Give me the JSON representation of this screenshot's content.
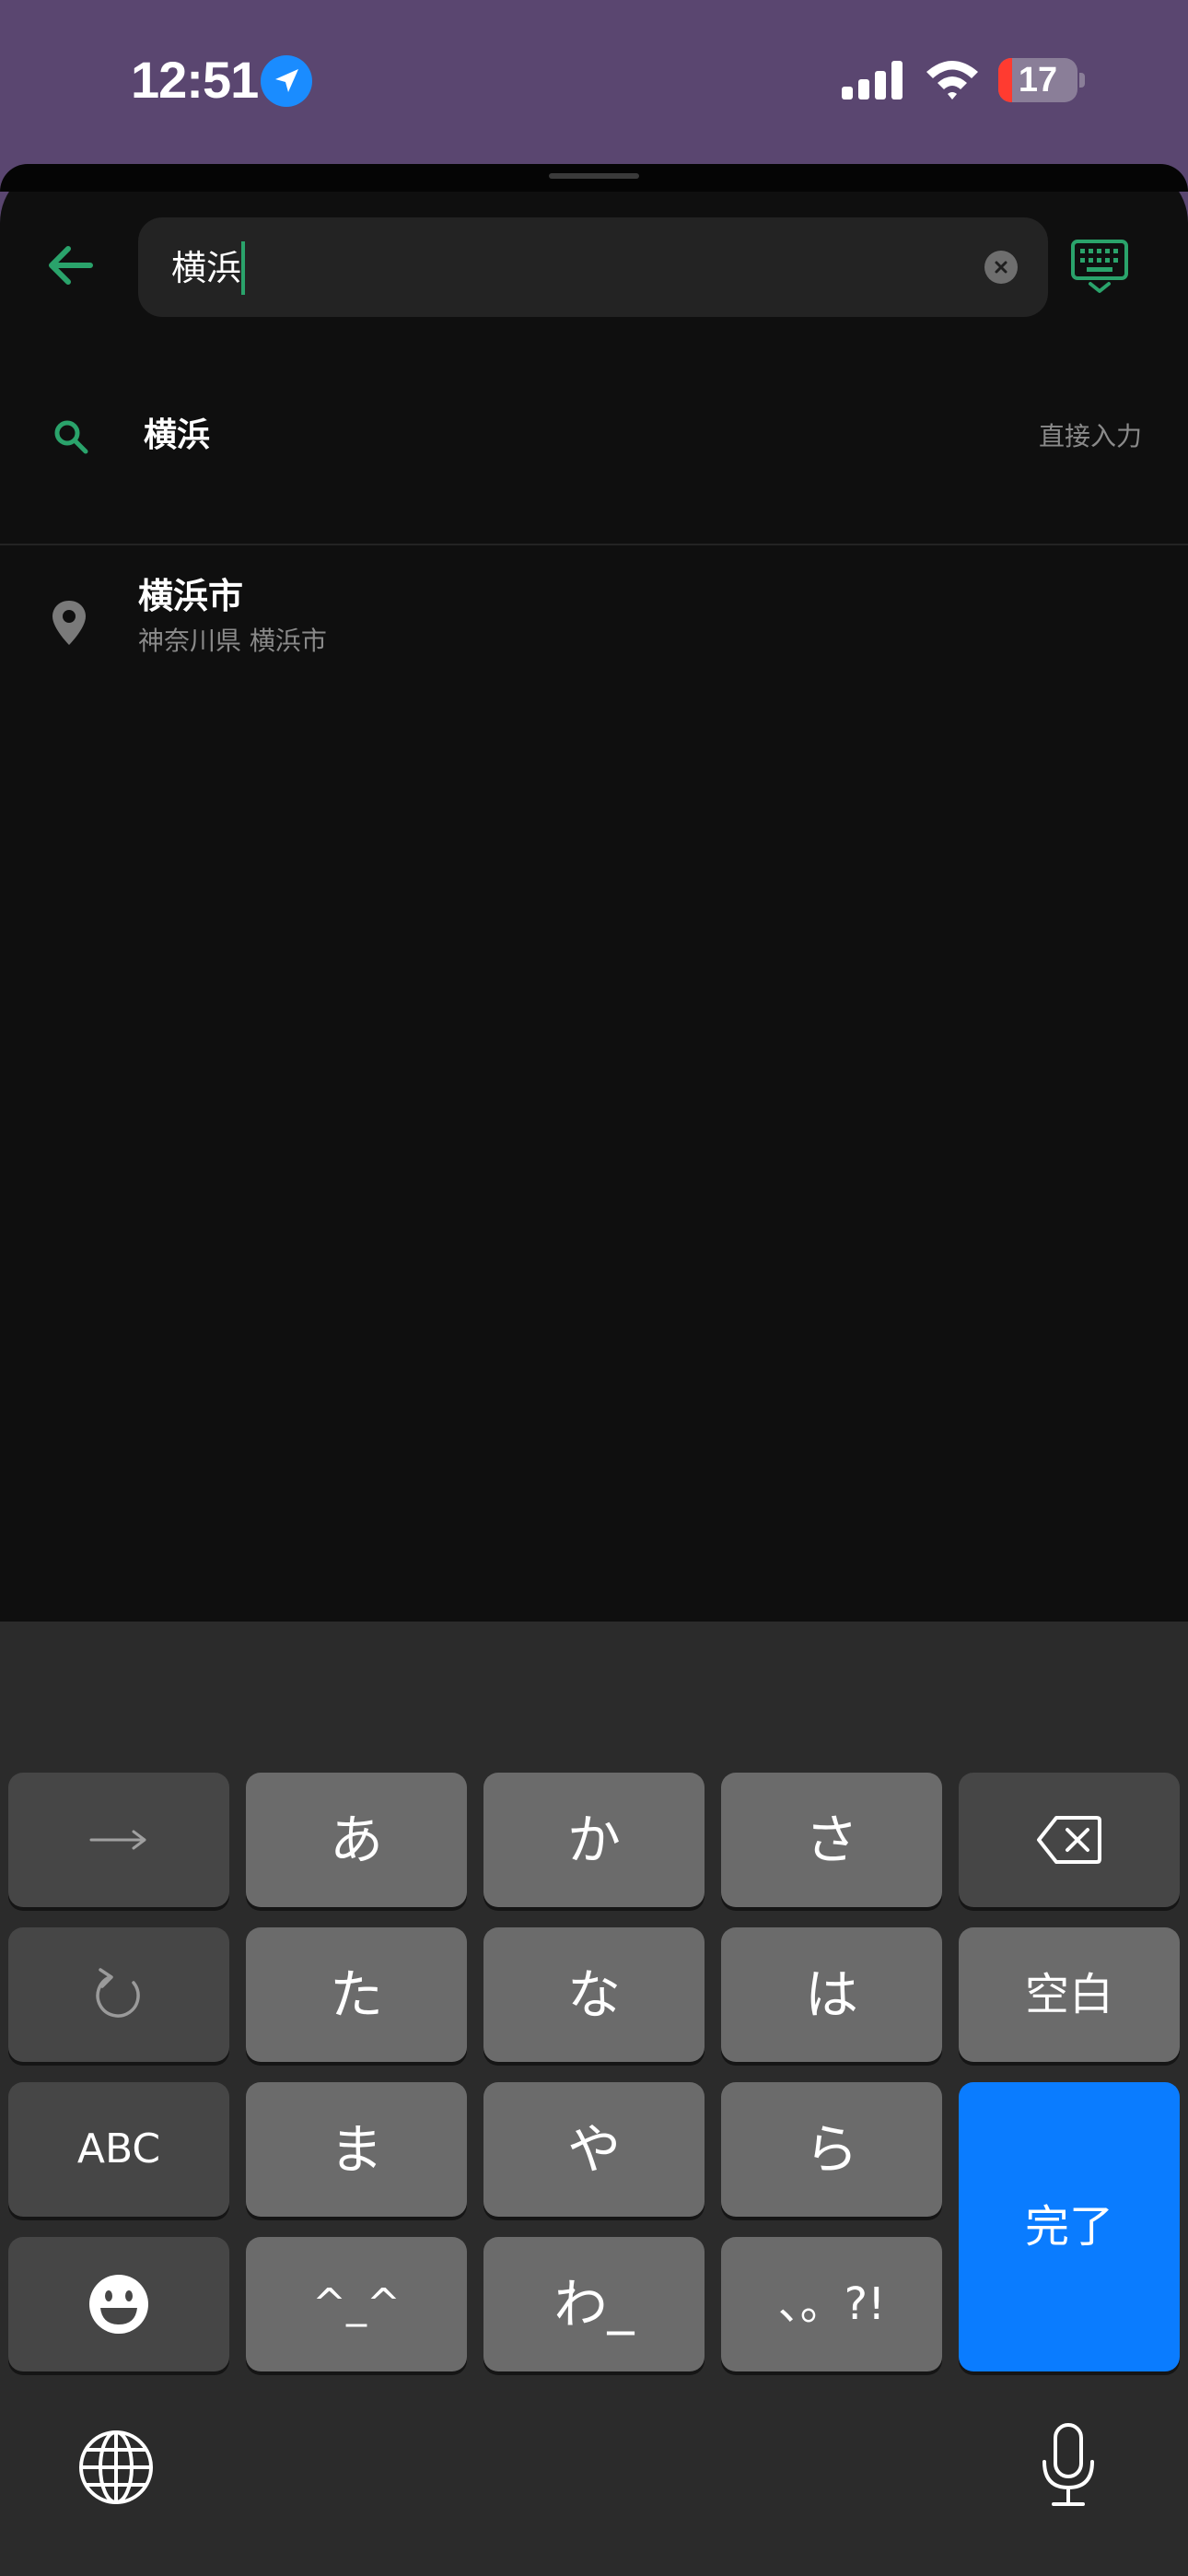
{
  "status_bar": {
    "time": "12:51",
    "battery_level": 17,
    "battery_text": "17"
  },
  "search": {
    "query": "横浜",
    "icons": {
      "back": "arrow-left-icon",
      "clear": "close-circle-icon",
      "keyboard": "keyboard-hide-icon"
    }
  },
  "results": {
    "query_row": {
      "title": "横浜",
      "action_label": "直接入力",
      "icon": "search-icon"
    },
    "places": [
      {
        "title": "横浜市",
        "subtitle": "神奈川県 横浜市",
        "icon": "map-pin-icon"
      }
    ]
  },
  "keyboard": {
    "row1": {
      "kana1": "あ",
      "kana2": "か",
      "kana3": "さ"
    },
    "row2": {
      "kana1": "た",
      "kana2": "な",
      "kana3": "は",
      "space": "空白"
    },
    "row3": {
      "abc": "ABC",
      "kana1": "ま",
      "kana2": "や",
      "kana3": "ら"
    },
    "row4": {
      "kaomoji": "^_^",
      "kana": "わ_",
      "punct": "、。?!"
    },
    "done": "完了",
    "icons": {
      "next": "arrow-right-icon",
      "undo": "undo-icon",
      "delete": "backspace-icon",
      "emoji": "emoji-icon",
      "globe": "globe-icon",
      "mic": "microphone-icon"
    },
    "colors": {
      "accent": "#0a7cff"
    }
  },
  "colors": {
    "brand_green": "#2aa36b",
    "status_bar": "#5a4670",
    "battery_low": "#ff3b30"
  }
}
